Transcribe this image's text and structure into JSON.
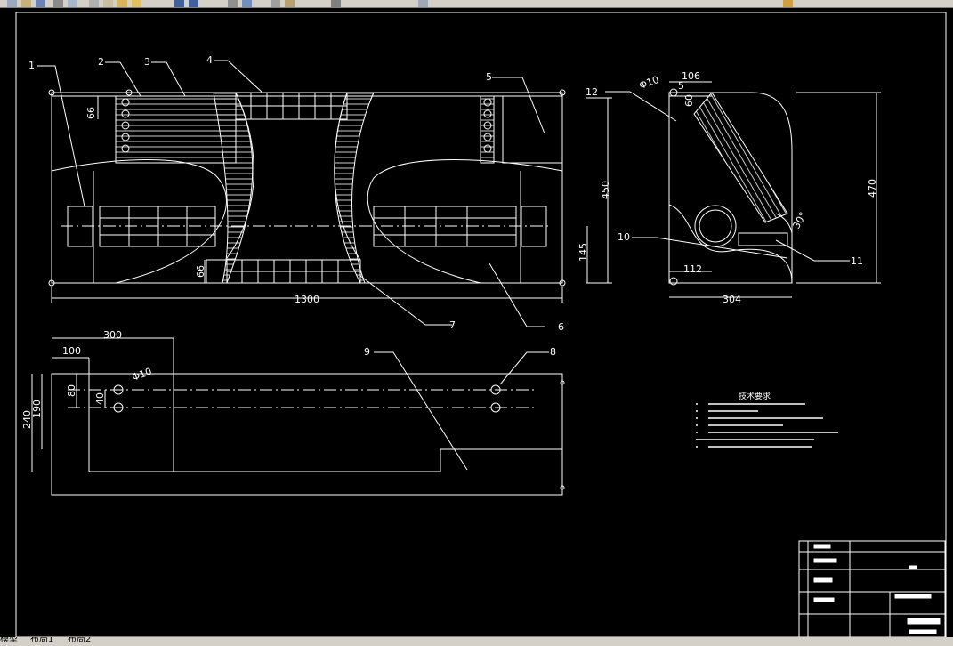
{
  "toolbar": {
    "icons": [
      "new-icon",
      "open-icon",
      "save-icon",
      "print-icon",
      "preview-icon",
      "cut-icon",
      "copy-icon",
      "paste-icon",
      "match-icon",
      "undo-icon",
      "redo-icon",
      "pan-icon",
      "zoom-icon",
      "properties-icon",
      "designcenter-icon",
      "toolpalette-icon",
      "calc-icon",
      "help-icon"
    ]
  },
  "drawing": {
    "callouts": [
      "1",
      "2",
      "3",
      "4",
      "5",
      "6",
      "7",
      "8",
      "9",
      "10",
      "11",
      "12"
    ],
    "dims_front": {
      "d66_top": "66",
      "d450": "450",
      "d145": "145",
      "d66_bottom": "66",
      "d1300": "1300"
    },
    "dims_side": {
      "d106": "106",
      "phi10": "Φ10",
      "d5": "5",
      "d60": "60",
      "d470": "470",
      "d30deg": "30°",
      "d112": "112",
      "d304": "304"
    },
    "dims_bottom": {
      "d300": "300",
      "d100": "100",
      "phi10": "Φ10",
      "d80": "80",
      "d40": "40",
      "d190": "190",
      "d240": "240"
    },
    "notes": {
      "title": "技术要求"
    }
  },
  "tabs": {
    "model": "模型",
    "layout1": "布局1",
    "layout2": "布局2"
  },
  "colors": {
    "background": "#000000",
    "lines": "#ffffff",
    "chrome": "#d4d0c8"
  }
}
